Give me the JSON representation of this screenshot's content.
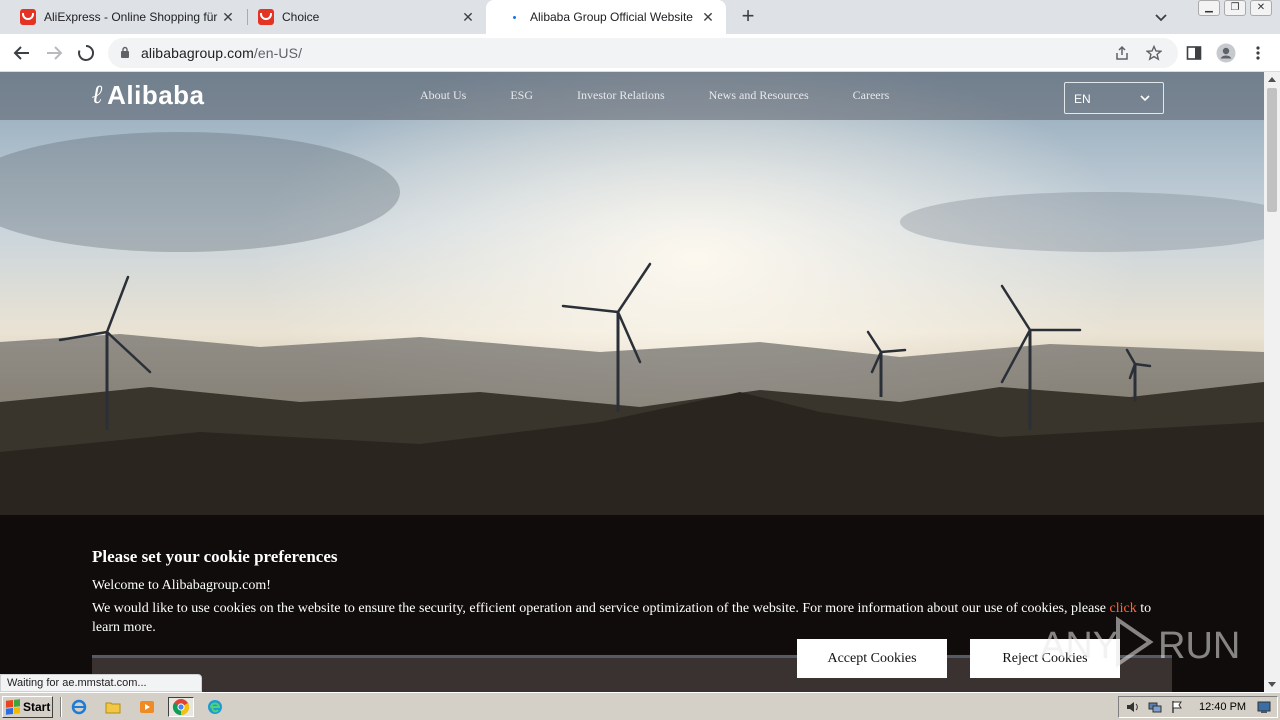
{
  "browser": {
    "tabs": [
      {
        "title": "AliExpress - Online Shopping für Elek",
        "favicon": "aliexpress-icon",
        "active": false
      },
      {
        "title": "Choice",
        "favicon": "aliexpress-icon",
        "active": false
      },
      {
        "title": "Alibaba Group Official Website",
        "favicon": "loading-icon",
        "active": true
      }
    ],
    "new_tab": "+",
    "url_host": "alibabagroup.com",
    "url_path": "/en-US/",
    "status": "Waiting for ae.mmstat.com..."
  },
  "site": {
    "logo_mark": "ℓ",
    "logo_text": "Alibaba",
    "nav": [
      "About Us",
      "ESG",
      "Investor Relations",
      "News and Resources",
      "Careers"
    ],
    "language": "EN"
  },
  "cookie": {
    "title": "Please set your cookie preferences",
    "welcome": "Welcome to Alibabagroup.com!",
    "body_before": "We would like to use cookies on the website to ensure the security, efficient operation and service optimization of the website. For more information about our use of cookies, please ",
    "link": "click",
    "body_after": " to learn more.",
    "accept": "Accept Cookies",
    "reject": "Reject Cookies"
  },
  "watermark": {
    "text": "ANY RUN"
  },
  "taskbar": {
    "start": "Start",
    "clock": "12:40 PM"
  },
  "colors": {
    "cookie_link": "#ff6a3d",
    "tab_strip": "#dee1e6",
    "aliexpress": "#e43225"
  }
}
